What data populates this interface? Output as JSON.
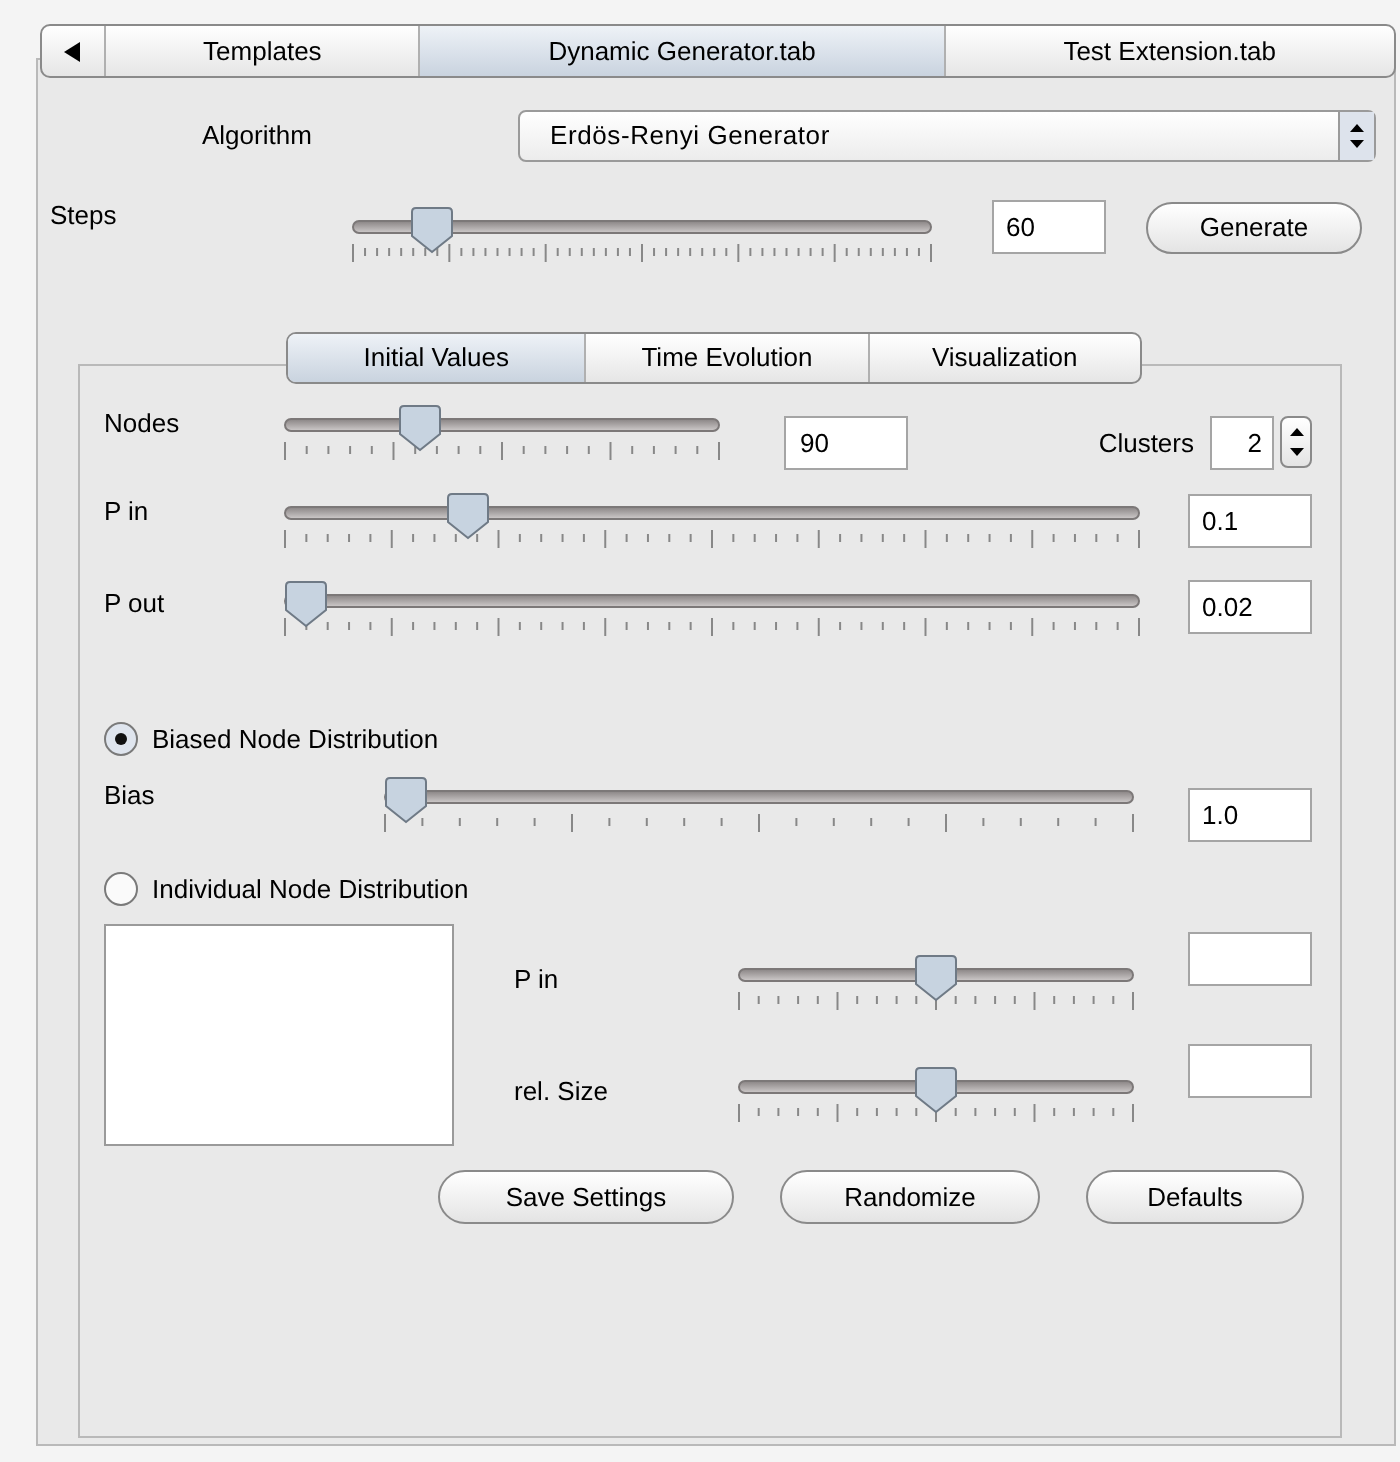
{
  "outer_tabs": [
    {
      "label": "Templates",
      "selected": false
    },
    {
      "label": "Dynamic Generator.tab",
      "selected": true
    },
    {
      "label": "Test Extension.tab",
      "selected": false
    }
  ],
  "algorithm": {
    "label": "Algorithm",
    "value": "Erdös-Renyi Generator"
  },
  "steps": {
    "label": "Steps",
    "level": 0.11,
    "value": "60"
  },
  "generate_button": "Generate",
  "inner_tabs": [
    {
      "label": "Initial Values",
      "selected": true
    },
    {
      "label": "Time Evolution",
      "selected": false
    },
    {
      "label": "Visualization",
      "selected": false
    }
  ],
  "nodes": {
    "label": "Nodes",
    "level": 0.29,
    "value": "90"
  },
  "clusters": {
    "label": "Clusters",
    "value": "2"
  },
  "p_in": {
    "label": "P in",
    "level": 0.2,
    "value": "0.1"
  },
  "p_out": {
    "label": "P out",
    "level": 0,
    "value": "0.02"
  },
  "distribution_options": [
    {
      "label": "Biased Node Distribution",
      "selected": true
    },
    {
      "label": "Individual Node Distribution",
      "selected": false
    }
  ],
  "bias": {
    "label": "Bias",
    "level": 0,
    "value": "1.0"
  },
  "individual": [
    {
      "label": "P in",
      "level": 0.5
    },
    {
      "label": "rel. Size",
      "level": 0.5
    }
  ],
  "buttons": [
    "Save Settings",
    "Randomize",
    "Defaults"
  ]
}
